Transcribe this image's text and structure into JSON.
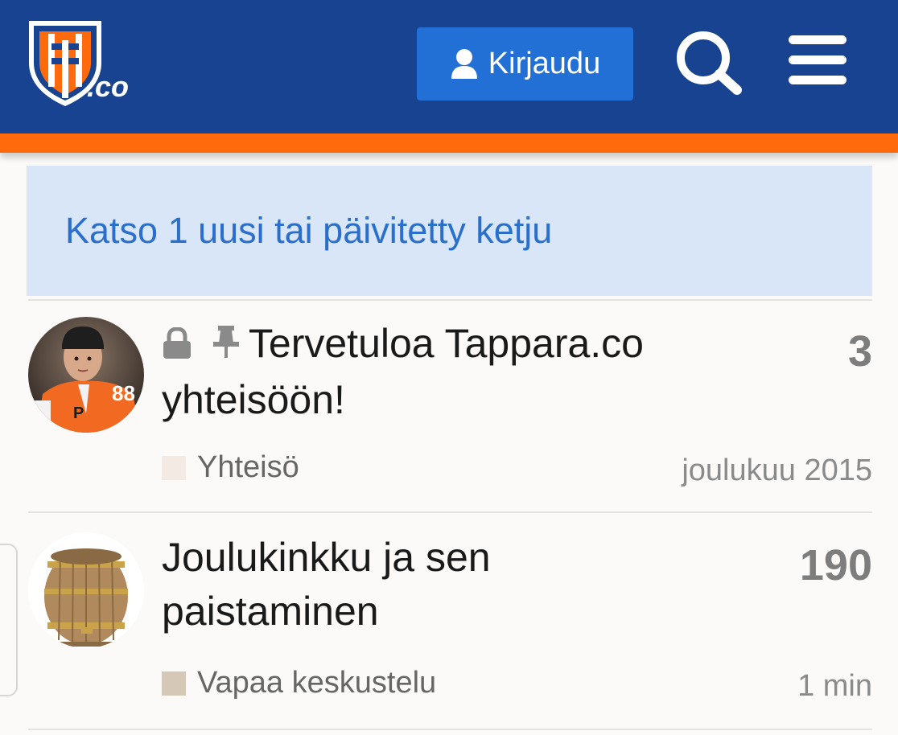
{
  "header": {
    "logo_text": ".co",
    "login_label": "Kirjaudu",
    "colors": {
      "header": "#174390",
      "stripe": "#ff6a0c",
      "login": "#2270d6"
    },
    "icons": {
      "login": "user-icon",
      "search": "search-icon",
      "menu": "hamburger-menu-icon"
    }
  },
  "notice": {
    "text": "Katso 1 uusi tai päivitetty ketju"
  },
  "topics": [
    {
      "title": "Tervetuloa Tappara.co yhteisöön!",
      "status_icons": [
        "lock-icon",
        "pin-icon"
      ],
      "replies": "3",
      "category": "Yhteisö",
      "category_color": "#f3ebe3",
      "activity": "joulukuu 2015",
      "avatar": "hockey-player-avatar"
    },
    {
      "title": "Joulukinkku ja sen paistaminen",
      "replies": "190",
      "category": "Vapaa keskustelu",
      "category_color": "#d5c8b6",
      "activity": "1 min",
      "avatar": "barrel-avatar"
    }
  ]
}
